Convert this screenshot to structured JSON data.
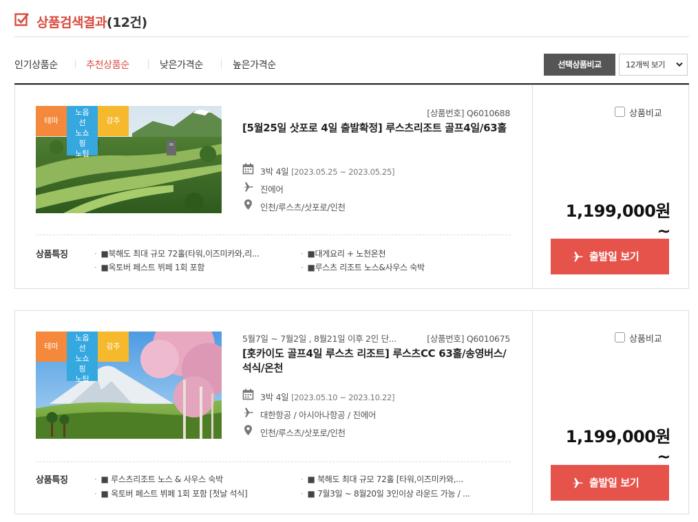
{
  "header": {
    "title": "상품검색결과",
    "count": "(12건)"
  },
  "sort": {
    "items": [
      {
        "label": "인기상품순"
      },
      {
        "label": "추천상품순"
      },
      {
        "label": "낮은가격순"
      },
      {
        "label": "높은가격순"
      }
    ],
    "compare_button": "선택상품비교",
    "per_page": "12개씩 보기"
  },
  "colors": {
    "accent": "#d94b3f",
    "button": "#e5534b",
    "tag_theme": "#f4893b",
    "tag_nooption": "#35a8e0",
    "tag_recommend": "#f6b92e"
  },
  "products": [
    {
      "tags": {
        "theme": "테마",
        "nooption": "노옵션노쇼핑노팁",
        "nooption_lines": [
          "노옵",
          "선",
          "노쇼",
          "핑",
          "노팁"
        ],
        "recommend": "강추"
      },
      "product_no": "[상품번호] Q6010688",
      "notice": "",
      "title": "[5월25일 삿포로 4일 출발확정] 루스츠리조트 골프4일/63홀",
      "duration": "3박 4일",
      "dates": "[2023.05.25 ~ 2023.05.25]",
      "airline": "진에어",
      "route": "인천/루스츠/삿포로/인천",
      "features_label": "상품특징",
      "features": [
        "■북해도 최대 규모 72홀(타워,이즈미카와,리...",
        "■대게요리 + 노천온천",
        "■옥토버 페스트 뷔페 1회 포함",
        "■루스츠 리조트 노스&사우스 숙박"
      ],
      "compare_label": "상품비교",
      "price": "1,199,000원~",
      "button": "출발일 보기",
      "icons": {
        "calendar": "calendar-icon",
        "airline": "plane-icon",
        "route": "location-pin-icon"
      }
    },
    {
      "tags": {
        "theme": "테마",
        "nooption": "노옵션노쇼핑노팁",
        "nooption_lines": [
          "노옵",
          "선",
          "노쇼",
          "핑",
          "노팁"
        ],
        "recommend": "강추"
      },
      "product_no": "[상품번호] Q6010675",
      "notice": "5월7일 ~ 7월2일 , 8월21일 이후 2인 단...",
      "title": "[홋카이도 골프4일 루스츠 리조트] 루스츠CC 63홀/송영버스/석식/온천",
      "duration": "3박 4일",
      "dates": "[2023.05.10 ~ 2023.10.22]",
      "airline": "대한항공 / 아시아나항공 / 진에어",
      "route": "인천/루스츠/삿포로/인천",
      "features_label": "상품특징",
      "features": [
        "■ 루스츠리조트 노스 & 사우스 숙박",
        "■ 북해도 최대 규모 72홀 [타워,이즈미카와,...",
        "■ 옥토버 페스트 뷔페 1회 포함 [첫날 석식]",
        "■ 7월3일 ~ 8월20일 3인이상 라운드 가능 / ..."
      ],
      "compare_label": "상품비교",
      "price": "1,199,000원~",
      "button": "출발일 보기",
      "icons": {
        "calendar": "calendar-icon",
        "airline": "plane-icon",
        "route": "location-pin-icon"
      }
    }
  ]
}
